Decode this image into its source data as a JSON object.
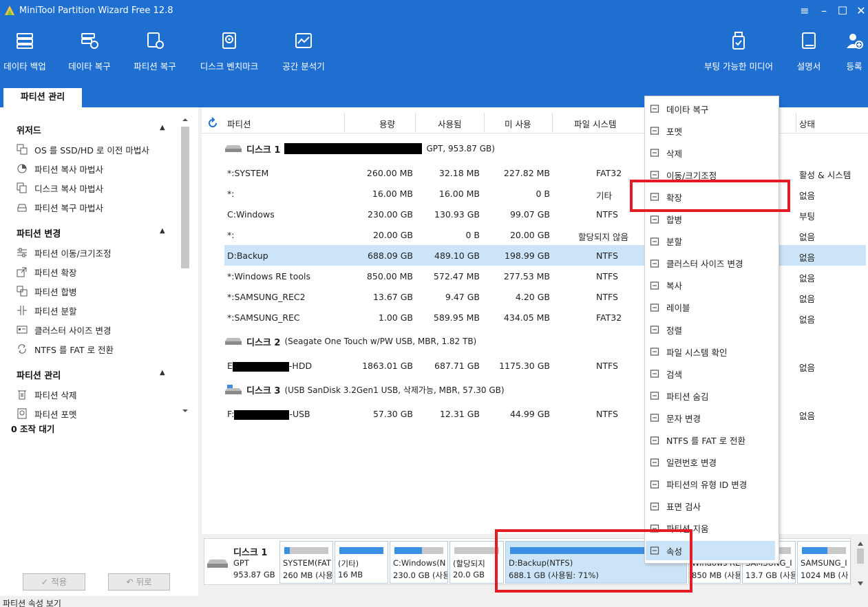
{
  "app": {
    "title": "MiniTool Partition Wizard Free 12.8"
  },
  "toolbar": {
    "items": [
      {
        "label": "데이타 백업",
        "icon": "server-backup-icon"
      },
      {
        "label": "데이타 복구",
        "icon": "data-recovery-icon"
      },
      {
        "label": "파티션 복구",
        "icon": "partition-recovery-icon"
      },
      {
        "label": "디스크 벤치마크",
        "icon": "disk-benchmark-icon"
      },
      {
        "label": "공간 분석기",
        "icon": "space-analyzer-icon"
      }
    ],
    "right": [
      {
        "label": "부팅 가능한 미디어",
        "icon": "usb-media-icon"
      },
      {
        "label": "설명서",
        "icon": "manual-book-icon"
      },
      {
        "label": "등록",
        "icon": "register-user-icon"
      }
    ]
  },
  "tab": {
    "label": "파티션 관리"
  },
  "sidebar": {
    "wizard": {
      "title": "위저드",
      "items": [
        "OS 를 SSD/HD 로 이전 마법사",
        "파티션 복사 마법사",
        "디스크 복사 마법사",
        "파티션 복구 마법사"
      ]
    },
    "change": {
      "title": "파티션 변경",
      "items": [
        "파티션 이동/크기조정",
        "파티션 확장",
        "파티션 합병",
        "파티션 분할",
        "클러스터 사이즈 변경",
        "NTFS 를 FAT 로 전환"
      ]
    },
    "manage": {
      "title": "파티션 관리",
      "items": [
        "파티션 삭제",
        "파티션 포멧"
      ]
    },
    "pending": "0 조작 대기",
    "apply": "✓ 적용",
    "undo": "↶ 뒤로"
  },
  "table": {
    "headers": {
      "partition": "파티션",
      "capacity": "용량",
      "used": "사용됨",
      "unused": "미 사용",
      "fs": "파일 시스템",
      "status": "상태"
    },
    "disk1": {
      "name": "디스크 1",
      "info": "GPT, 953.87 GB)"
    },
    "disk2": {
      "name": "디스크 2",
      "info": "(Seagate One Touch w/PW USB, MBR, 1.82 TB)"
    },
    "disk3": {
      "name": "디스크 3",
      "info": "(USB SanDisk 3.2Gen1 USB, 삭제가능, MBR, 57.30 GB)"
    },
    "rows1": [
      {
        "name": "*:SYSTEM",
        "cap": "260.00 MB",
        "used": "32.18 MB",
        "unused": "227.82 MB",
        "fs": "FAT32",
        "status": "활성 & 시스템"
      },
      {
        "name": "*:",
        "cap": "16.00 MB",
        "used": "16.00 MB",
        "unused": "0 B",
        "fs": "기타",
        "status": "없음"
      },
      {
        "name": "C:Windows",
        "cap": "230.00 GB",
        "used": "130.93 GB",
        "unused": "99.07 GB",
        "fs": "NTFS",
        "status": "부팅"
      },
      {
        "name": "*:",
        "cap": "20.00 GB",
        "used": "0 B",
        "unused": "20.00 GB",
        "fs": "할당되지 않음",
        "status": "없음"
      },
      {
        "name": "D:Backup",
        "cap": "688.09 GB",
        "used": "489.10 GB",
        "unused": "198.99 GB",
        "fs": "NTFS",
        "status": "없음"
      },
      {
        "name": "*:Windows RE tools",
        "cap": "850.00 MB",
        "used": "572.47 MB",
        "unused": "277.53 MB",
        "fs": "NTFS",
        "status": "없음"
      },
      {
        "name": "*:SAMSUNG_REC2",
        "cap": "13.67 GB",
        "used": "9.47 GB",
        "unused": "4.20 GB",
        "fs": "NTFS",
        "status": "없음"
      },
      {
        "name": "*:SAMSUNG_REC",
        "cap": "1.00 GB",
        "used": "589.95 MB",
        "unused": "434.05 MB",
        "fs": "FAT32",
        "status": "없음"
      }
    ],
    "row2": {
      "prefix": "E",
      "suffix": "-HDD",
      "cap": "1863.01 GB",
      "used": "687.71 GB",
      "unused": "1175.30 GB",
      "fs": "NTFS",
      "status": "없음"
    },
    "row3": {
      "prefix": "F:",
      "suffix": "-USB",
      "cap": "57.30 GB",
      "used": "12.31 GB",
      "unused": "44.99 GB",
      "fs": "NTFS",
      "status": "없음"
    }
  },
  "diskmap": {
    "disk": {
      "name": "디스크 1",
      "type": "GPT",
      "size": "953.87 GB"
    },
    "blocks": [
      {
        "l1": "SYSTEM(FAT",
        "l2": "260 MB (사용",
        "fill": 0.12
      },
      {
        "l1": "(기타)",
        "l2": "16 MB",
        "fill": 1.0
      },
      {
        "l1": "C:Windows(N",
        "l2": "230.0 GB (사용",
        "fill": 0.57
      },
      {
        "l1": "(할당되지",
        "l2": "20.0 GB",
        "fill": 0.0
      },
      {
        "l1": "D:Backup(NTFS)",
        "l2": "688.1 GB (사용됨: 71%)",
        "fill": 0.96
      },
      {
        "l1": "Windows RE",
        "l2": "850 MB (사용",
        "fill": 0.67
      },
      {
        "l1": "SAMSUNG_I",
        "l2": "13.7 GB (사용",
        "fill": 0.69
      },
      {
        "l1": "SAMSUNG_I",
        "l2": "1024 MB (사",
        "fill": 0.58
      }
    ]
  },
  "status_bar": "파티션 속성 보기",
  "context_menu": {
    "items": [
      "데이타 복구",
      "포멧",
      "삭제",
      "이동/크기조정",
      "확장",
      "합병",
      "분할",
      "클러스터 사이즈 변경",
      "복사",
      "레이블",
      "정렬",
      "파일 시스템 확인",
      "검색",
      "파티션 숨김",
      "문자 변경",
      "NTFS 를 FAT 로 전환",
      "일련번호 변경",
      "파티션의 유형 ID 변경",
      "표면 검사",
      "파티션 지움",
      "속성"
    ]
  },
  "colors": {
    "header": "#1f6fd1",
    "selection": "#cce4f7",
    "highlight_box": "#e51b23",
    "bar_fill": "#3a8ee6"
  }
}
